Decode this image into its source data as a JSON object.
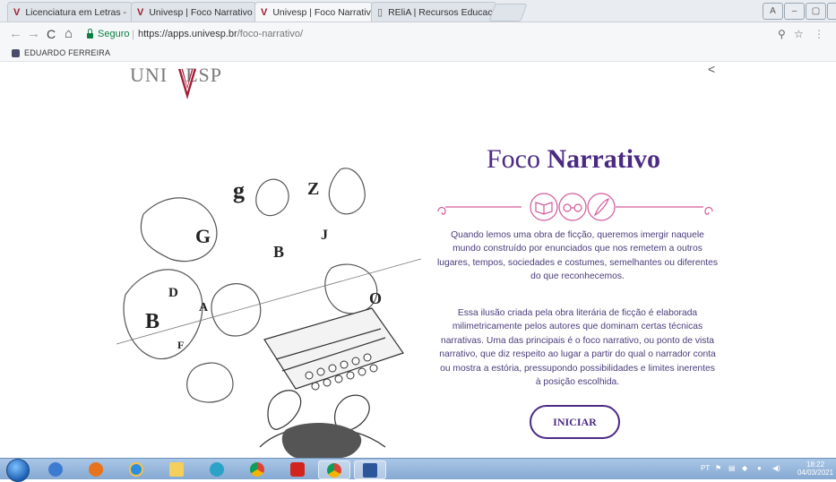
{
  "browser": {
    "tabs": [
      {
        "label": "Licenciatura em Letras -",
        "active": false
      },
      {
        "label": "Univesp | Foco Narrativo",
        "active": false
      },
      {
        "label": "Univesp | Foco Narrativo",
        "active": true
      },
      {
        "label": "REliA | Recursos Educac",
        "active": false
      }
    ],
    "tab_close": "×",
    "secure_label": "Seguro",
    "url_host": "https://apps.univesp.br",
    "url_path": "/foco-narrativo/",
    "bookmark_user": "EDUARDO FERREIRA"
  },
  "page": {
    "logo_text_left": "UNI",
    "logo_text_right": "ESP",
    "title_light": "Foco ",
    "title_bold": "Narrativo",
    "paragraph1": "Quando lemos uma obra de ficção, queremos imergir naquele mundo construído por enunciados que nos remetem a outros lugares, tempos, sociedades e costumes, semelhantes ou diferentes do que reconhecemos.",
    "paragraph2": "Essa ilusão criada pela obra literária de ficção é elaborada milimetricamente pelos autores que dominam certas técnicas narrativas. Uma das principais é o foco narrativo, ou ponto de vista narrativo, que diz respeito ao lugar a partir do qual o narrador conta ou mostra a estória, pressupondo possibilidades e limites inerentes à posição escolhida.",
    "start_button": "INICIAR",
    "illustration_letters": [
      "g",
      "Z",
      "G",
      "B",
      "J",
      "D",
      "B",
      "F",
      "A",
      "O"
    ]
  },
  "taskbar": {
    "lang": "PT",
    "time": "18:22",
    "date": "04/03/2021"
  },
  "colors": {
    "accent": "#4b2a82",
    "ornament": "#d35a9a",
    "logo_v": "#a41d36"
  },
  "icons": [
    "univesp-tab-icon",
    "doc-tab-icon",
    "back-icon",
    "forward-icon",
    "reload-icon",
    "home-icon",
    "lock-icon",
    "zoom-icon",
    "star-icon",
    "menu-icon",
    "share-icon",
    "book-icon",
    "glasses-icon",
    "feather-icon"
  ]
}
